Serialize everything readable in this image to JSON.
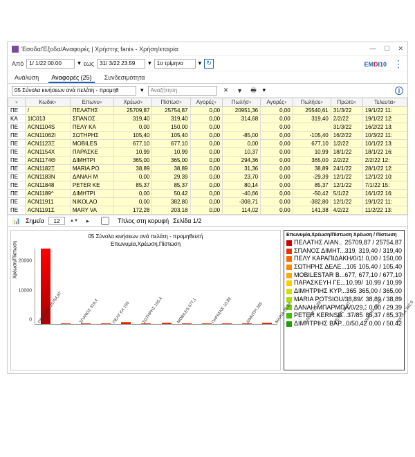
{
  "window": {
    "title": "Έσοδα/Έξοδα/Αναφορές | Χρήστης fanis - Χρήση/εταιρία:"
  },
  "toolbar1": {
    "from_label": "Από",
    "from_value": "1/ 1/22 00.00",
    "to_label": "εως",
    "to_value": "31/ 3/22 23.59",
    "period": "1ο τρίμηνο"
  },
  "tabs": {
    "t1": "Ανάλυση",
    "t2": "Αναφορές (25)",
    "t3": "Συνδεσιμότητα"
  },
  "toolbar2": {
    "report": "05 Σύνολα κινήσεων ανά πελάτη - προμηθ",
    "search_ph": "Αναζήτηση"
  },
  "grid": {
    "headers": {
      "h0": "",
      "h1": "Κωδικ",
      "h2": "Επωνυ",
      "h3": "Χρέωσ",
      "h4": "Πίστωσ",
      "h5": "Αγορές",
      "h6": "Πωλήσ",
      "h7": "Αγορές",
      "h8": "Πωλήσε",
      "h9": "Πρώτο",
      "h10": "Τελευτα"
    },
    "rows": [
      {
        "c0": "ΠΕ",
        "c1": "/",
        "c2": "ΠΕΛΑΤΗΣ",
        "c3": "25709,87",
        "c4": "25754,87",
        "c5": "0,00",
        "c6": "20951,36",
        "c7": "0,00",
        "c8": "25540,61",
        "c9": "31/3/22",
        "c10": "19/1/22 11:"
      },
      {
        "c0": "ΚΑ",
        "c1": "1IC013",
        "c2": "ΣΠΑΝΟΣ .",
        "c3": "319,40",
        "c4": "319,40",
        "c5": "0,00",
        "c6": "314,68",
        "c7": "0,00",
        "c8": "319,40",
        "c9": "2/2/22",
        "c10": "19/1/22 12:"
      },
      {
        "c0": "ΠΕ",
        "c1": "ACN1104S",
        "c2": "ΠΕΛΥ ΚΑ",
        "c3": "0,00",
        "c4": "150,00",
        "c5": "0,00",
        "c6": "",
        "c7": "0,00",
        "c8": "",
        "c9": "31/3/22",
        "c10": "16/2/22 13:"
      },
      {
        "c0": "ΠΕ",
        "c1": "ACN11062I",
        "c2": "ΣΩΤΗΡΗΣ",
        "c3": "105,40",
        "c4": "105,40",
        "c5": "0,00",
        "c6": "-85,00",
        "c7": "0,00",
        "c8": "-105,40",
        "c9": "16/2/22",
        "c10": "10/3/22 11:"
      },
      {
        "c0": "ΠΕ",
        "c1": "ACN1123Ξ",
        "c2": "MOBILES",
        "c3": "677,10",
        "c4": "677,10",
        "c5": "0,00",
        "c6": "0,00",
        "c7": "0,00",
        "c8": "677,10",
        "c9": "1/2/22",
        "c10": "10/1/22 13:"
      },
      {
        "c0": "ΠΕ",
        "c1": "ACN1154Χ",
        "c2": "ΠΑΡΑΣΚΕ",
        "c3": "10,99",
        "c4": "10,99",
        "c5": "0,00",
        "c6": "10,37",
        "c7": "0,00",
        "c8": "10,99",
        "c9": "18/1/22",
        "c10": "18/1/22 16:"
      },
      {
        "c0": "ΠΕ",
        "c1": "ACN1174Θ",
        "c2": "ΔΙΜΗΤΡΙ",
        "c3": "365,00",
        "c4": "365,00",
        "c5": "0,00",
        "c6": "294,36",
        "c7": "0,00",
        "c8": "365,00",
        "c9": "2/2/22",
        "c10": "2/2/22 12:"
      },
      {
        "c0": "ΠΕ",
        "c1": "ACN1182Ξ",
        "c2": "MARIA PO",
        "c3": "38,89",
        "c4": "38,89",
        "c5": "0,00",
        "c6": "31,36",
        "c7": "0,00",
        "c8": "38,89",
        "c9": "24/1/22",
        "c10": "28/1/22 12:"
      },
      {
        "c0": "ΠΕ",
        "c1": "ACN1183Ν",
        "c2": "ΔΑΝΑΗ Μ",
        "c3": "0,00",
        "c4": "29,39",
        "c5": "0,00",
        "c6": "23,70",
        "c7": "0,00",
        "c8": "-29,39",
        "c9": "12/1/22",
        "c10": "12/1/22 10:"
      },
      {
        "c0": "ΠΕ",
        "c1": "ACN11848",
        "c2": "PETER KE",
        "c3": "85,37",
        "c4": "85,37",
        "c5": "0,00",
        "c6": "80,14",
        "c7": "0,00",
        "c8": "85,37",
        "c9": "12/1/22",
        "c10": "7/1/22 15:"
      },
      {
        "c0": "ΠΕ",
        "c1": "ACN1189^",
        "c2": "ΔΙΜΗΤΡΙ",
        "c3": "0,00",
        "c4": "50,42",
        "c5": "0,00",
        "c6": "-40,66",
        "c7": "0,00",
        "c8": "-50,42",
        "c9": "5/1/22",
        "c10": "16/1/22 16:"
      },
      {
        "c0": "ΠΕ",
        "c1": "ACN11911",
        "c2": "NIKOLAO",
        "c3": "0,00",
        "c4": "382,80",
        "c5": "0,00",
        "c6": "-308,71",
        "c7": "0,00",
        "c8": "-382,80",
        "c9": "12/1/22",
        "c10": "19/1/22 11:"
      },
      {
        "c0": "ΠΕ",
        "c1": "ACN1191Σ",
        "c2": "MARY VA",
        "c3": "172,28",
        "c4": "203,18",
        "c5": "0,00",
        "c6": "114,02",
        "c7": "0,00",
        "c8": "141,38",
        "c9": "4/2/22",
        "c10": "11/2/22 13:"
      }
    ]
  },
  "gridfoot": {
    "points_label": "Σημεία",
    "points_value": "12",
    "title_label": "Τίτλος στη κορυφή",
    "page_label": "Σελίδα 1/2"
  },
  "chart": {
    "title": "05 Σύνολα κινήσεων ανά πελάτη - προμηθευτή",
    "subtitle": "Επωνυμία,Χρέωση,Πίστωση",
    "ylabel": "Χρέωση/Πίστωση"
  },
  "legend": {
    "header": "Επωνυμία,Χρέωση/Πίστωση Χρέωση / Πίστωση",
    "items": [
      {
        "sw": "#cc0000",
        "name": "ΠΕΛΑΤΗΣ ΛΙΑΝ...25709,87/25754,87",
        "val": "25709,87 / 25754,87"
      },
      {
        "sw": "#e63500",
        "name": "ΣΠΑΝΟΣ ΔΙΜΗΤ...319,4/319,4",
        "val": "319,40 / 319,40"
      },
      {
        "sw": "#ff6600",
        "name": "ΠΕΛΥ ΚΑΡΑΠΙΔΑΚΗ/0/150",
        "val": "0,00 / 150,00"
      },
      {
        "sw": "#ff8800",
        "name": "ΣΩΤΗΡΗΣ ΔΕΛΕ...105,4/105,4",
        "val": "105,40 / 105,40"
      },
      {
        "sw": "#ffaa00",
        "name": "MOBILESTAR B...677,1/677,1",
        "val": "677,10 / 677,10"
      },
      {
        "sw": "#ffcc00",
        "name": "ΠΑΡΑΣΚΕΥΗ ΓΕ...10,99/10,99",
        "val": "10,99 / 10,99"
      },
      {
        "sw": "#d4e000",
        "name": "ΔΙΜΗΤΡΙΗΣ ΚΥΡ...365/365",
        "val": "365,00 / 365,00"
      },
      {
        "sw": "#a8e000",
        "name": "MARIA POTSIOU/38,89/38,89",
        "val": "38,89 / 38,89"
      },
      {
        "sw": "#70d000",
        "name": "ΔΑΝΑΗ ΜΠΑΡΜΠΑ/0/29,39",
        "val": "0,00 / 29,39"
      },
      {
        "sw": "#40c000",
        "name": "PETER KERNSB...37/85,37",
        "val": "85,37 / 85,37"
      },
      {
        "sw": "#20a000",
        "name": "ΔΙΜΗΤΡΙΗΣ ΒΑΡ...0/50,42",
        "val": "0,00 / 50,42"
      }
    ]
  },
  "chart_data": {
    "type": "bar",
    "title": "05 Σύνολα κινήσεων ανά πελάτη - προμηθευτή",
    "subtitle": "Επωνυμία,Χρέωση,Πίστωση",
    "ylabel": "Χρέωση/Πίστωση",
    "ylim": [
      0,
      26000
    ],
    "yticks": [
      0,
      10000,
      20000
    ],
    "categories": [
      "ΠΕΛΑΤΗΣ 25754,87",
      "ΣΠΑΝΟΣ 319,4",
      "ΠΕΛΥ ΚΑ 150",
      "ΣΩΤΗΡΗΣ 105,4",
      "MOBILES 677,1",
      "ΠΑΡΑΣΚΕ 10,99",
      "ΔΙΜΗΤΡΙ 365",
      "MARIA 38,89",
      "ΔΑΝΑΗ 29,39",
      "PETER 85,37",
      "ΔΙΜΗΤΡΙ 50,42",
      "NIKOLA 382,8"
    ],
    "series": [
      {
        "name": "Χρέωση",
        "values": [
          25709.87,
          319.4,
          0,
          105.4,
          677.1,
          10.99,
          365.0,
          38.89,
          0,
          85.37,
          0,
          0
        ]
      },
      {
        "name": "Πίστωση",
        "values": [
          25754.87,
          319.4,
          150.0,
          105.4,
          677.1,
          10.99,
          365.0,
          38.89,
          29.39,
          85.37,
          50.42,
          382.8
        ]
      }
    ]
  }
}
